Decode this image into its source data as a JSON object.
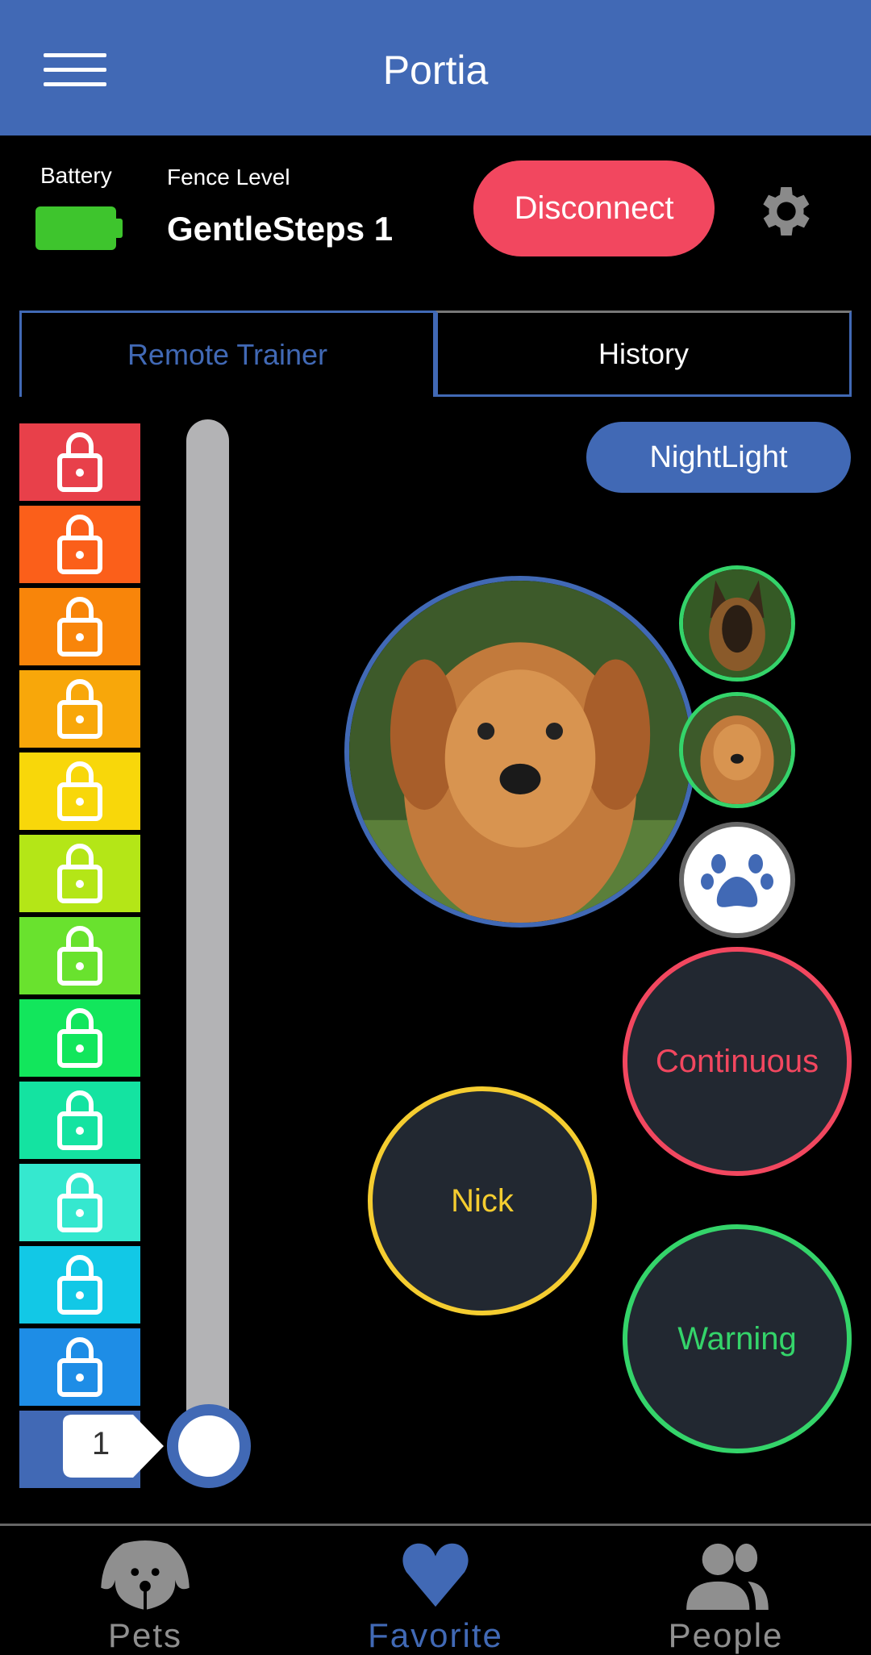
{
  "header": {
    "title": "Portia",
    "menu_icon": "hamburger-icon"
  },
  "status": {
    "battery_label": "Battery",
    "battery_color": "#3ec52d",
    "fence_label": "Fence Level",
    "fence_value": "GentleSteps 1",
    "disconnect_label": "Disconnect",
    "settings_icon": "gear-icon"
  },
  "tabs": [
    {
      "label": "Remote Trainer",
      "active": true
    },
    {
      "label": "History",
      "active": false
    }
  ],
  "levels": {
    "colors": [
      "#e8404a",
      "#fb5f1a",
      "#f8850a",
      "#f8a70a",
      "#f8d70a",
      "#b4e617",
      "#69e22e",
      "#12e65c",
      "#14e3a1",
      "#35e8cf",
      "#12c8e6",
      "#1e8de6",
      "#4169b5"
    ],
    "locked_count": 12,
    "selected_level": "1"
  },
  "nightlight_label": "NightLight",
  "actions": {
    "continuous": "Continuous",
    "nick": "Nick",
    "warning": "Warning",
    "colors": {
      "continuous": "#f2475f",
      "nick": "#f5cd30",
      "warning": "#34d46a"
    }
  },
  "nav": [
    {
      "label": "Pets",
      "icon": "dog-icon"
    },
    {
      "label": "Favorite",
      "icon": "heart-icon",
      "active": true
    },
    {
      "label": "People",
      "icon": "people-icon"
    }
  ]
}
